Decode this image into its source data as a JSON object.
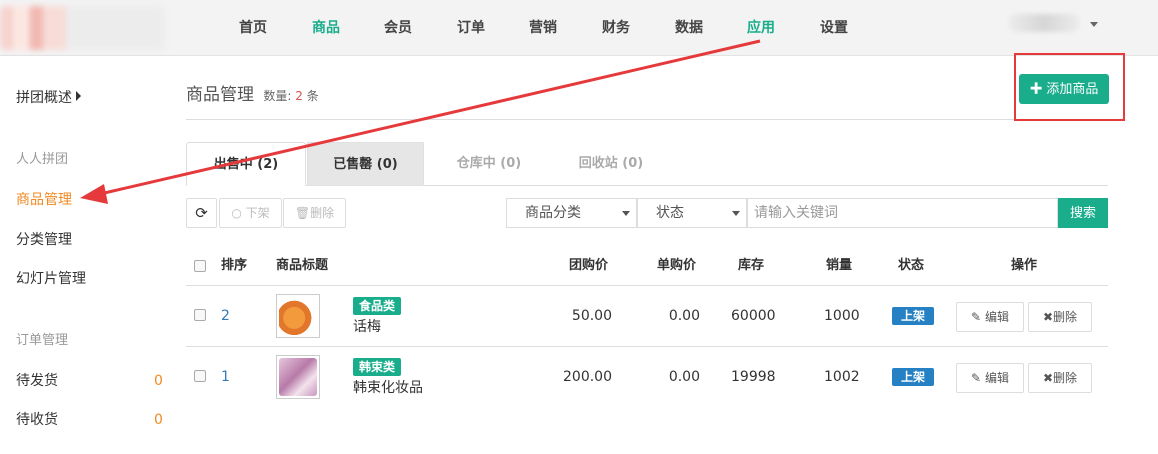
{
  "nav": {
    "items": [
      "首页",
      "商品",
      "会员",
      "订单",
      "营销",
      "财务",
      "数据",
      "应用",
      "设置"
    ]
  },
  "sidebar": {
    "overview": "拼团概述",
    "group1": "人人拼团",
    "product_manage": "商品管理",
    "category_manage": "分类管理",
    "slides_manage": "幻灯片管理",
    "group2": "订单管理",
    "pending_ship": "待发货",
    "pending_ship_count": "0",
    "pending_receive": "待收货",
    "pending_receive_count": "0"
  },
  "header": {
    "title": "商品管理",
    "count_label": "数量:",
    "count_value": "2",
    "count_unit": "条",
    "add_button": "添加商品"
  },
  "tabs": [
    "出售中 (2)",
    "已售罄 (0)",
    "仓库中 (0)",
    "回收站 (0)"
  ],
  "toolbar": {
    "offshelf": "下架",
    "delete": "删除",
    "category_select": "商品分类",
    "status_select": "状态",
    "search_placeholder": "请输入关键词",
    "search_button": "搜索"
  },
  "table": {
    "headers": [
      "排序",
      "商品标题",
      "团购价",
      "单购价",
      "库存",
      "销量",
      "状态",
      "操作"
    ],
    "rows": [
      {
        "sort": "2",
        "category": "食品类",
        "name": "话梅",
        "group_price": "50.00",
        "single_price": "0.00",
        "stock": "60000",
        "sales": "1000",
        "status": "上架",
        "edit": "编辑",
        "delete": "删除"
      },
      {
        "sort": "1",
        "category": "韩束类",
        "name": "韩束化妆品",
        "group_price": "200.00",
        "single_price": "0.00",
        "stock": "19998",
        "sales": "1002",
        "status": "上架",
        "edit": "编辑",
        "delete": "删除"
      }
    ]
  },
  "colors": {
    "accent": "#1aad8c",
    "active_side": "#f08a23",
    "annotation": "#e5393b",
    "status_blue": "#2581c4"
  }
}
